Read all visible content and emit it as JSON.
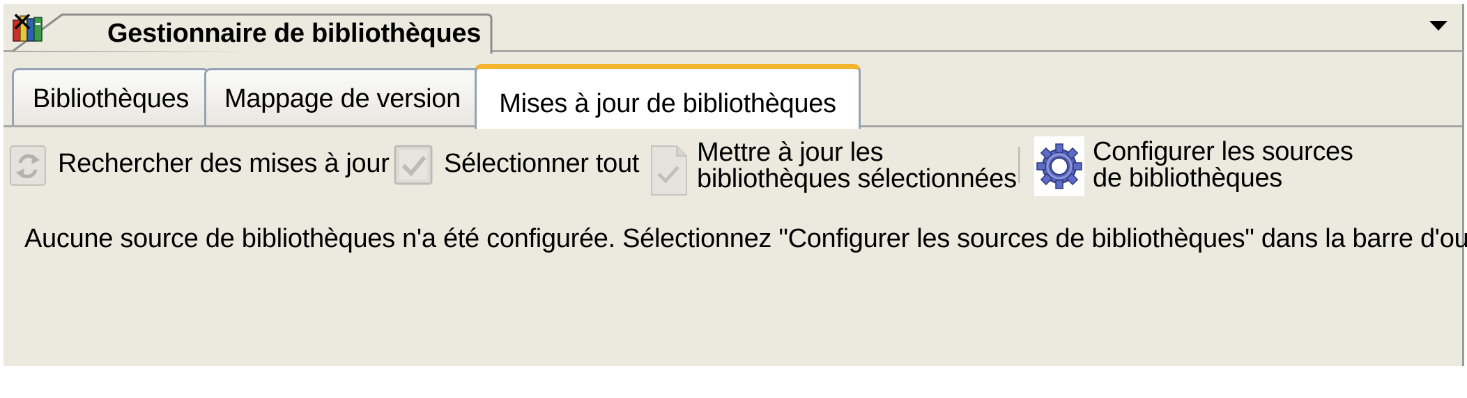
{
  "doc_tab": {
    "title": "Gestionnaire de bibliothèques",
    "icon": "books-icon",
    "close_icon": "close-icon"
  },
  "panel_menu_icon": "chevron-down-icon",
  "tabs": [
    {
      "label": "Bibliothèques",
      "active": false
    },
    {
      "label": "Mappage de version",
      "active": false
    },
    {
      "label": "Mises à jour de bibliothèques",
      "active": true
    }
  ],
  "toolbar": {
    "search": {
      "label": "Rechercher des mises à jour",
      "icon": "refresh-icon",
      "enabled": false
    },
    "select_all": {
      "label": "Sélectionner tout",
      "icon": "checkbox-icon",
      "enabled": false
    },
    "update": {
      "label_line1": "Mettre à jour les",
      "label_line2": "bibliothèques sélectionnées",
      "icon": "document-check-icon",
      "enabled": false
    },
    "configure": {
      "label_line1": "Configurer les sources",
      "label_line2": "de bibliothèques",
      "icon": "gear-icon",
      "enabled": true
    }
  },
  "message": "Aucune source de bibliothèques n'a été configurée. Sélectionnez \"Configurer les sources de bibliothèques\" dans la barre d'outils.",
  "colors": {
    "panel_background": "#ece9de",
    "active_tab_accent": "#f4b52c",
    "tab_border": "#95a3b3"
  }
}
